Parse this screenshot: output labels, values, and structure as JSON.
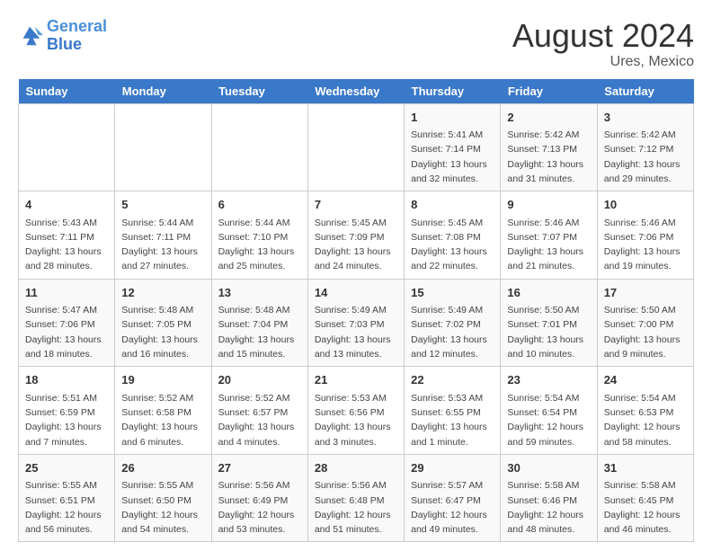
{
  "logo": {
    "line1": "General",
    "line2": "Blue"
  },
  "title": "August 2024",
  "subtitle": "Ures, Mexico",
  "days_header": [
    "Sunday",
    "Monday",
    "Tuesday",
    "Wednesday",
    "Thursday",
    "Friday",
    "Saturday"
  ],
  "weeks": [
    [
      {
        "day": "",
        "info": ""
      },
      {
        "day": "",
        "info": ""
      },
      {
        "day": "",
        "info": ""
      },
      {
        "day": "",
        "info": ""
      },
      {
        "day": "1",
        "info": "Sunrise: 5:41 AM\nSunset: 7:14 PM\nDaylight: 13 hours\nand 32 minutes."
      },
      {
        "day": "2",
        "info": "Sunrise: 5:42 AM\nSunset: 7:13 PM\nDaylight: 13 hours\nand 31 minutes."
      },
      {
        "day": "3",
        "info": "Sunrise: 5:42 AM\nSunset: 7:12 PM\nDaylight: 13 hours\nand 29 minutes."
      }
    ],
    [
      {
        "day": "4",
        "info": "Sunrise: 5:43 AM\nSunset: 7:11 PM\nDaylight: 13 hours\nand 28 minutes."
      },
      {
        "day": "5",
        "info": "Sunrise: 5:44 AM\nSunset: 7:11 PM\nDaylight: 13 hours\nand 27 minutes."
      },
      {
        "day": "6",
        "info": "Sunrise: 5:44 AM\nSunset: 7:10 PM\nDaylight: 13 hours\nand 25 minutes."
      },
      {
        "day": "7",
        "info": "Sunrise: 5:45 AM\nSunset: 7:09 PM\nDaylight: 13 hours\nand 24 minutes."
      },
      {
        "day": "8",
        "info": "Sunrise: 5:45 AM\nSunset: 7:08 PM\nDaylight: 13 hours\nand 22 minutes."
      },
      {
        "day": "9",
        "info": "Sunrise: 5:46 AM\nSunset: 7:07 PM\nDaylight: 13 hours\nand 21 minutes."
      },
      {
        "day": "10",
        "info": "Sunrise: 5:46 AM\nSunset: 7:06 PM\nDaylight: 13 hours\nand 19 minutes."
      }
    ],
    [
      {
        "day": "11",
        "info": "Sunrise: 5:47 AM\nSunset: 7:06 PM\nDaylight: 13 hours\nand 18 minutes."
      },
      {
        "day": "12",
        "info": "Sunrise: 5:48 AM\nSunset: 7:05 PM\nDaylight: 13 hours\nand 16 minutes."
      },
      {
        "day": "13",
        "info": "Sunrise: 5:48 AM\nSunset: 7:04 PM\nDaylight: 13 hours\nand 15 minutes."
      },
      {
        "day": "14",
        "info": "Sunrise: 5:49 AM\nSunset: 7:03 PM\nDaylight: 13 hours\nand 13 minutes."
      },
      {
        "day": "15",
        "info": "Sunrise: 5:49 AM\nSunset: 7:02 PM\nDaylight: 13 hours\nand 12 minutes."
      },
      {
        "day": "16",
        "info": "Sunrise: 5:50 AM\nSunset: 7:01 PM\nDaylight: 13 hours\nand 10 minutes."
      },
      {
        "day": "17",
        "info": "Sunrise: 5:50 AM\nSunset: 7:00 PM\nDaylight: 13 hours\nand 9 minutes."
      }
    ],
    [
      {
        "day": "18",
        "info": "Sunrise: 5:51 AM\nSunset: 6:59 PM\nDaylight: 13 hours\nand 7 minutes."
      },
      {
        "day": "19",
        "info": "Sunrise: 5:52 AM\nSunset: 6:58 PM\nDaylight: 13 hours\nand 6 minutes."
      },
      {
        "day": "20",
        "info": "Sunrise: 5:52 AM\nSunset: 6:57 PM\nDaylight: 13 hours\nand 4 minutes."
      },
      {
        "day": "21",
        "info": "Sunrise: 5:53 AM\nSunset: 6:56 PM\nDaylight: 13 hours\nand 3 minutes."
      },
      {
        "day": "22",
        "info": "Sunrise: 5:53 AM\nSunset: 6:55 PM\nDaylight: 13 hours\nand 1 minute."
      },
      {
        "day": "23",
        "info": "Sunrise: 5:54 AM\nSunset: 6:54 PM\nDaylight: 12 hours\nand 59 minutes."
      },
      {
        "day": "24",
        "info": "Sunrise: 5:54 AM\nSunset: 6:53 PM\nDaylight: 12 hours\nand 58 minutes."
      }
    ],
    [
      {
        "day": "25",
        "info": "Sunrise: 5:55 AM\nSunset: 6:51 PM\nDaylight: 12 hours\nand 56 minutes."
      },
      {
        "day": "26",
        "info": "Sunrise: 5:55 AM\nSunset: 6:50 PM\nDaylight: 12 hours\nand 54 minutes."
      },
      {
        "day": "27",
        "info": "Sunrise: 5:56 AM\nSunset: 6:49 PM\nDaylight: 12 hours\nand 53 minutes."
      },
      {
        "day": "28",
        "info": "Sunrise: 5:56 AM\nSunset: 6:48 PM\nDaylight: 12 hours\nand 51 minutes."
      },
      {
        "day": "29",
        "info": "Sunrise: 5:57 AM\nSunset: 6:47 PM\nDaylight: 12 hours\nand 49 minutes."
      },
      {
        "day": "30",
        "info": "Sunrise: 5:58 AM\nSunset: 6:46 PM\nDaylight: 12 hours\nand 48 minutes."
      },
      {
        "day": "31",
        "info": "Sunrise: 5:58 AM\nSunset: 6:45 PM\nDaylight: 12 hours\nand 46 minutes."
      }
    ]
  ]
}
